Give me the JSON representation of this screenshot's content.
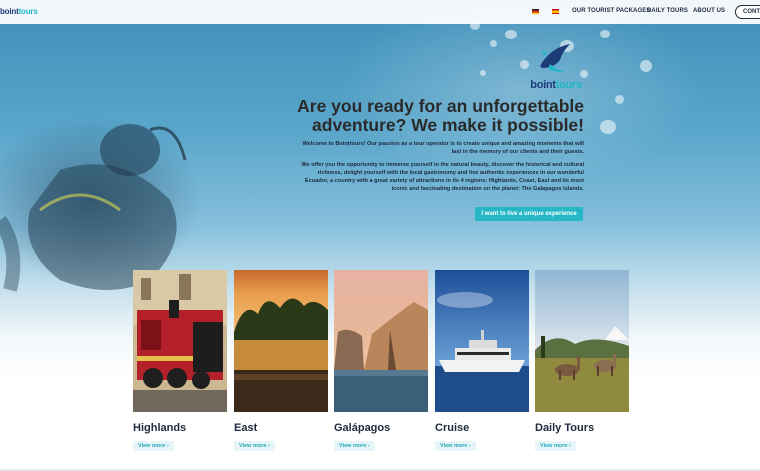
{
  "nav": {
    "logo": "bointtours",
    "logo_part1": "boint",
    "logo_part2": "tours",
    "links": [
      "OUR TOURIST PACKAGES",
      "DAILY TOURS",
      "ABOUT US"
    ],
    "contact": "CONTA",
    "flags": [
      "german-flag-icon",
      "spanish-flag-icon"
    ]
  },
  "brand": {
    "name_part1": "boint",
    "name_part2": "tours",
    "icon": "bird-logo-icon"
  },
  "hero": {
    "headline": "Are you ready for an unforgettable adventure? We make it possible!",
    "intro": "Welcome to Bointtours! Our passion as a tour operator is to create unique and amazing moments that will last in the memory of our clients and their guests.",
    "body": "We offer you the opportunity to immerse yourself in the natural beauty, discover the historical and cultural richness, delight yourself with the local gastronomy and live authentic experiences in our wonderful Ecuador, a country with a great variety of attractions in its 4 regions: Highlands, Coast, East and its most iconic and fascinating destination on the planet: The Galapagos Islands.",
    "cta": "I want to live a unique experience"
  },
  "cards": [
    {
      "title": "Highlands",
      "link": "View more",
      "arrow": "›"
    },
    {
      "title": "East",
      "link": "View more",
      "arrow": "›"
    },
    {
      "title": "Galápagos",
      "link": "View more",
      "arrow": "›"
    },
    {
      "title": "Cruise",
      "link": "View more",
      "arrow": "›"
    },
    {
      "title": "Daily Tours",
      "link": "View more",
      "arrow": "›"
    }
  ],
  "colors": {
    "accent": "#25b7c6",
    "brand_dark": "#1c3c7a",
    "text_dark": "#1f2a3c"
  }
}
